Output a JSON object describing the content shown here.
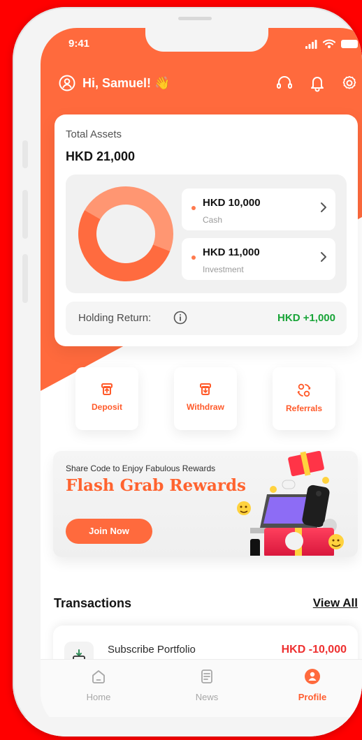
{
  "colors": {
    "accent": "#ff6a3d",
    "positive": "#18a437",
    "negative": "#ee3030"
  },
  "status_bar": {
    "time": "9:41"
  },
  "header": {
    "greeting": "Hi, Samuel! 👋"
  },
  "assets": {
    "label": "Total Assets",
    "total": "HKD 21,000",
    "rows": [
      {
        "amount": "HKD 10,000",
        "label": "Cash"
      },
      {
        "amount": "HKD 11,000",
        "label": "Investment"
      }
    ],
    "holding_label": "Holding Return:",
    "holding_value": "HKD +1,000",
    "donut": {
      "type": "pie",
      "slices": [
        {
          "label": "Cash",
          "value": 10000,
          "color": "#ff9672"
        },
        {
          "label": "Investment",
          "value": 11000,
          "color": "#ff6b3f"
        }
      ]
    }
  },
  "actions": [
    {
      "label": "Deposit",
      "icon": "deposit-icon"
    },
    {
      "label": "Withdraw",
      "icon": "withdraw-icon"
    },
    {
      "label": "Referrals",
      "icon": "referrals-icon"
    }
  ],
  "promo": {
    "subtitle": "Share Code to Enjoy Fabulous Rewards",
    "title": "Flash Grab Rewards",
    "button": "Join Now"
  },
  "transactions": {
    "title": "Transactions",
    "view_all": "View All",
    "items": [
      {
        "name": "Subscribe Portfolio",
        "amount": "HKD -10,000"
      }
    ]
  },
  "tabs": [
    {
      "label": "Home"
    },
    {
      "label": "News"
    },
    {
      "label": "Profile"
    }
  ]
}
